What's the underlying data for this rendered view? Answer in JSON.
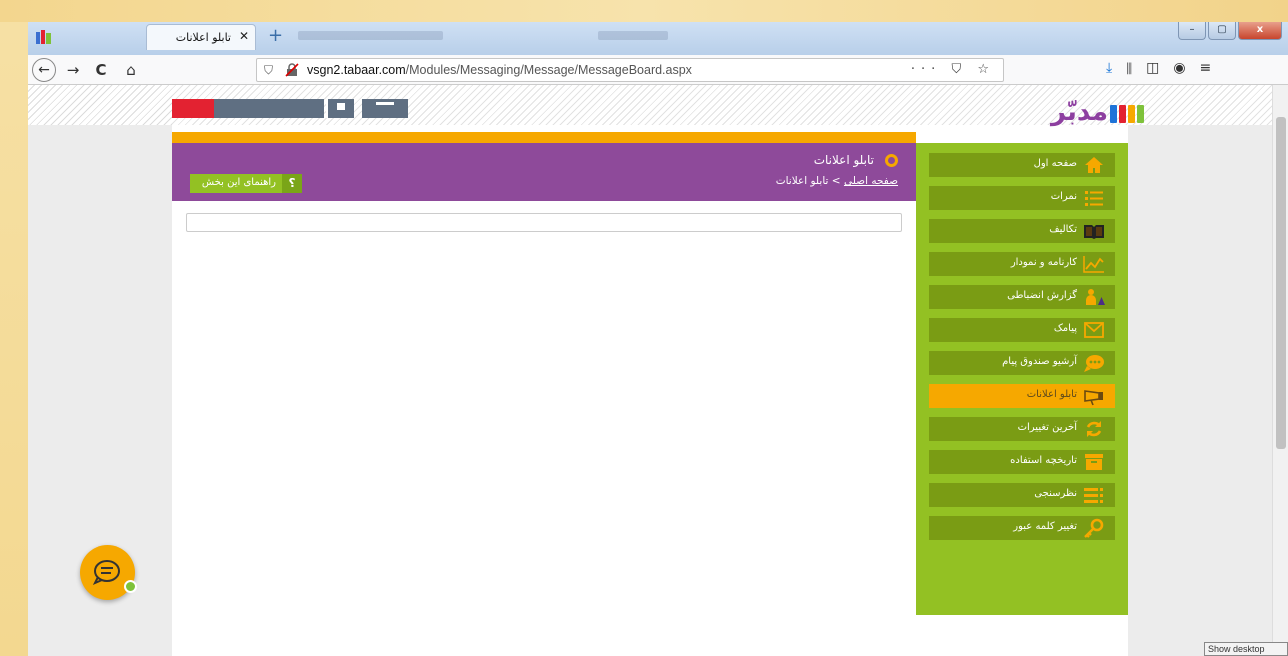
{
  "browser": {
    "tab_title": "تابلو اعلانات",
    "tab_close_glyph": "✕",
    "new_tab_glyph": "+",
    "url_domain": "vsgn2.tabaar.com",
    "url_path": "/Modules/Messaging/Message/MessageBoard.aspx",
    "url_actions": "··· ⛉ ☆",
    "nav_back": "←",
    "nav_forward": "→",
    "nav_reload": "C",
    "nav_home": "⌂",
    "toolbar_icons": [
      "download-icon",
      "library-icon",
      "sidebar-icon",
      "account-icon",
      "menu-icon"
    ],
    "window_buttons": {
      "minimize": "–",
      "maximize": "▢",
      "close": "x"
    }
  },
  "site": {
    "logo_text": "مدبّر",
    "logo_colors": [
      "#1e73d8",
      "#e32231",
      "#f6a800",
      "#7ec23a"
    ]
  },
  "page": {
    "title": "تابلو اعلانات",
    "breadcrumb_home": "صفحه اصلی",
    "breadcrumb_sep": ">",
    "breadcrumb_current": "تابلو اعلانات",
    "help_button": "راهنمای این بخش",
    "help_icon": "؟"
  },
  "sidebar": {
    "items": [
      {
        "label": "صفحه اول",
        "icon": "home-icon"
      },
      {
        "label": "نمرات",
        "icon": "list-numbered-icon"
      },
      {
        "label": "تکالیف",
        "icon": "book-icon"
      },
      {
        "label": "کارنامه و نمودار",
        "icon": "chart-line-icon"
      },
      {
        "label": "گزارش انضباطی",
        "icon": "discipline-icon"
      },
      {
        "label": "پیامک",
        "icon": "envelope-icon"
      },
      {
        "label": "آرشیو صندوق پیام",
        "icon": "speech-bubble-icon"
      },
      {
        "label": "تابلو اعلانات",
        "icon": "megaphone-icon",
        "active": true
      },
      {
        "label": "آخرین تغییرات",
        "icon": "refresh-icon"
      },
      {
        "label": "تاریخچه استفاده",
        "icon": "archive-box-icon"
      },
      {
        "label": "نظرسنجی",
        "icon": "survey-list-icon"
      },
      {
        "label": "تغییر کلمه عبور",
        "icon": "key-icon"
      }
    ]
  },
  "colors": {
    "accent_orange": "#f6a800",
    "header_purple": "#8e4a9a",
    "sidebar_green": "#93c123",
    "sidebar_item_green": "#7a9c14"
  },
  "taskbar": {
    "show_desktop": "Show desktop"
  }
}
